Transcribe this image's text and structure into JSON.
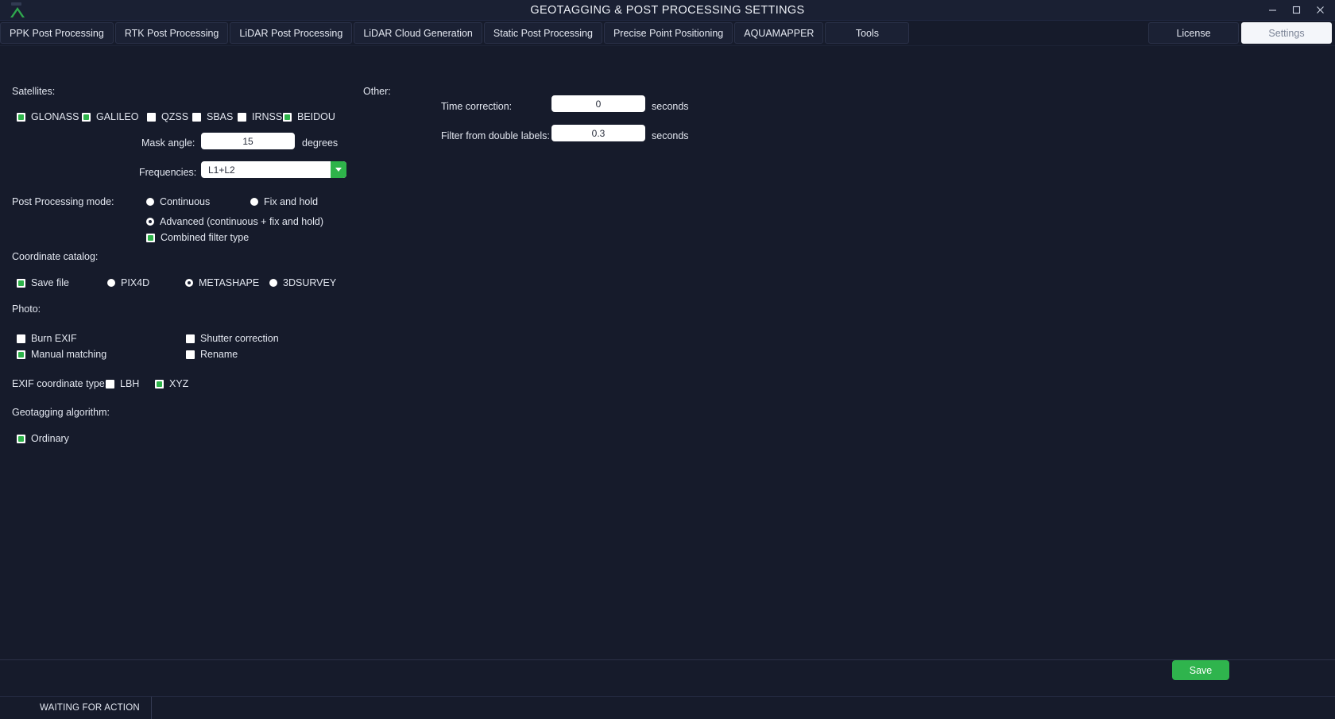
{
  "window": {
    "title": "GEOTAGGING & POST PROCESSING SETTINGS",
    "icon": "survey-cone-icon",
    "minimize_label": "minimize-icon",
    "maximize_label": "maximize-icon",
    "close_label": "close-icon"
  },
  "tabs": [
    {
      "label": "PPK Post Processing"
    },
    {
      "label": "RTK Post Processing"
    },
    {
      "label": "LiDAR Post Processing"
    },
    {
      "label": "LiDAR Cloud Generation"
    },
    {
      "label": "Static Post Processing"
    },
    {
      "label": "Precise Point Positioning"
    },
    {
      "label": "AQUAMAPPER"
    },
    {
      "label": "Tools"
    }
  ],
  "right_buttons": {
    "license": "License",
    "settings": "Settings"
  },
  "satellites": {
    "heading": "Satellites:",
    "items": [
      {
        "label": "GLONASS",
        "checked": true
      },
      {
        "label": "GALILEO",
        "checked": true
      },
      {
        "label": "QZSS",
        "checked": false
      },
      {
        "label": "SBAS",
        "checked": false
      },
      {
        "label": "IRNSS",
        "checked": false
      },
      {
        "label": "BEIDOU",
        "checked": true
      }
    ],
    "mask_angle_label": "Mask angle:",
    "mask_angle_value": "15",
    "mask_angle_unit": "degrees",
    "frequencies_label": "Frequencies:",
    "frequencies_value": "L1+L2"
  },
  "post_processing": {
    "heading": "Post Processing mode:",
    "modes": [
      {
        "label": "Continuous",
        "selected": false
      },
      {
        "label": "Fix and hold",
        "selected": false
      },
      {
        "label": "Advanced (continuous + fix and hold)",
        "selected": true
      }
    ],
    "combined_filter": {
      "label": "Combined filter type",
      "checked": true
    }
  },
  "coordinate_catalog": {
    "heading": "Coordinate catalog:",
    "save_file": {
      "label": "Save file",
      "checked": true
    },
    "options": [
      {
        "label": "PIX4D",
        "selected": false
      },
      {
        "label": "METASHAPE",
        "selected": true
      },
      {
        "label": "3DSURVEY",
        "selected": false
      }
    ]
  },
  "photo": {
    "heading": "Photo:",
    "items": [
      {
        "label": "Burn EXIF",
        "checked": false
      },
      {
        "label": "Shutter correction",
        "checked": false
      },
      {
        "label": "Manual matching",
        "checked": true
      },
      {
        "label": "Rename",
        "checked": false
      }
    ]
  },
  "exif_coordinate_type": {
    "heading": "EXIF coordinate type:",
    "items": [
      {
        "label": "LBH",
        "checked": false
      },
      {
        "label": "XYZ",
        "checked": true
      }
    ]
  },
  "geotagging_algorithm": {
    "heading": "Geotagging algorithm:",
    "items": [
      {
        "label": "Ordinary",
        "checked": true
      }
    ]
  },
  "other": {
    "heading": "Other:",
    "time_correction_label": "Time correction:",
    "time_correction_value": "0",
    "time_correction_unit": "seconds",
    "filter_double_labels_label": "Filter from double labels:",
    "filter_double_labels_value": "0.3",
    "filter_double_labels_unit": "seconds"
  },
  "footer": {
    "save_label": "Save",
    "status_text": "WAITING FOR ACTION"
  },
  "colors": {
    "accent_green": "#2eb34a",
    "window_bg": "#161b2b",
    "titlebar_bg": "#1a2033"
  }
}
